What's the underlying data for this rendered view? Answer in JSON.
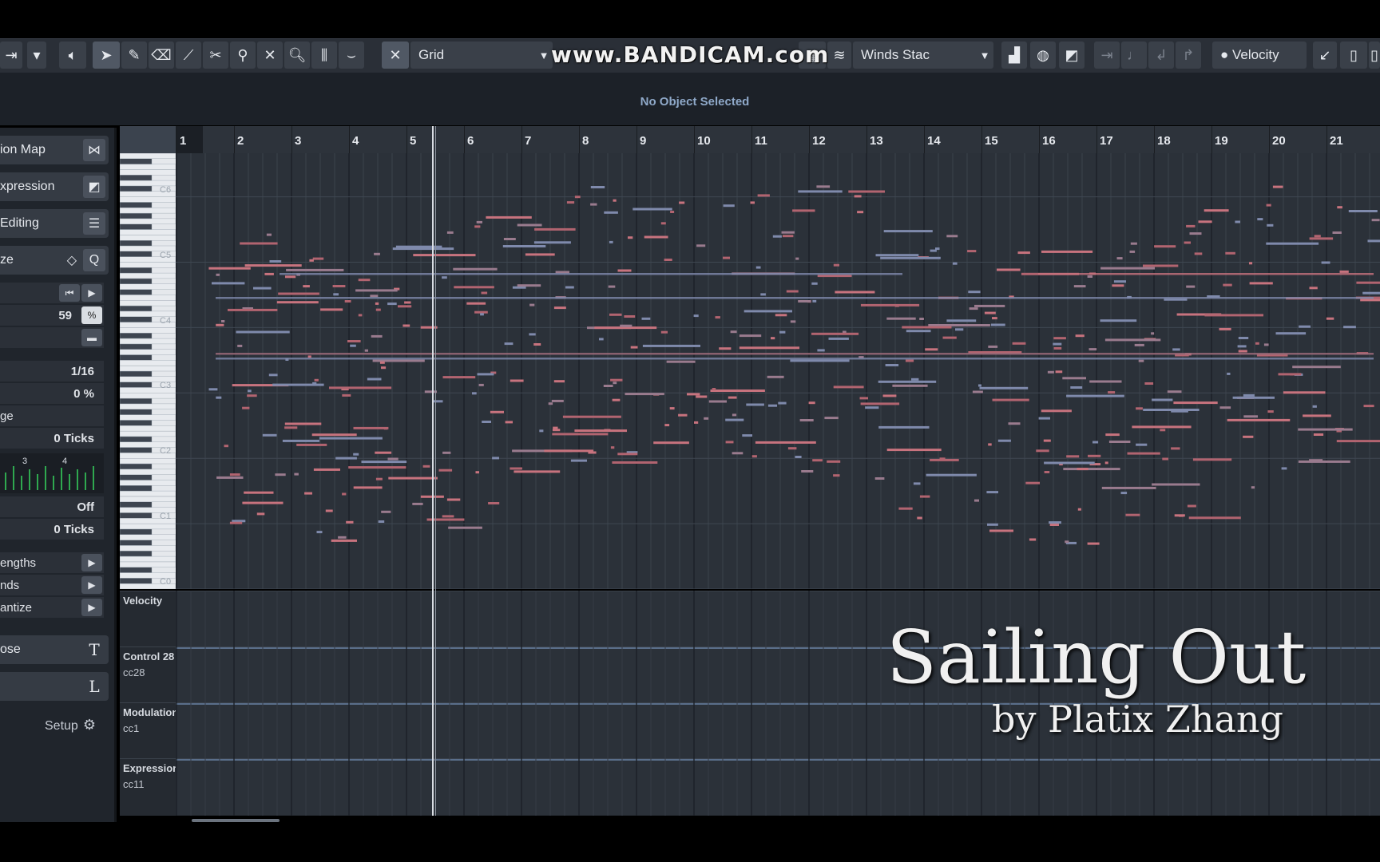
{
  "toolbar": {
    "quantize_label": "Grid",
    "bandicam": "www.BANDICAM.com",
    "instrument_label": "Winds Stac",
    "velocity_label": "Velocity"
  },
  "info_line": {
    "text": "No Object Selected"
  },
  "inspector": {
    "sections": [
      {
        "label": "ion Map",
        "icon": "⋈"
      },
      {
        "label": "xpression",
        "icon": "◩"
      },
      {
        "label": "Editing",
        "icon": "☰"
      },
      {
        "label": "ze",
        "icon": "Q"
      }
    ],
    "value_59": "59",
    "grid_value": "1/16",
    "percent": "0 %",
    "ge_label": "ge",
    "ticks1": "0 Ticks",
    "off": "Off",
    "ticks2": "0 Ticks",
    "func_rows": [
      "engths",
      "nds",
      "antize"
    ],
    "transpose": {
      "label": "ose",
      "icon": "T"
    },
    "logical": {
      "label": "",
      "icon": "L"
    },
    "setup": "Setup",
    "meter_labels": [
      "3",
      "4"
    ]
  },
  "ruler": {
    "bars": [
      "1",
      "2",
      "3",
      "4",
      "5",
      "6",
      "7",
      "8",
      "9",
      "10",
      "11",
      "12",
      "13",
      "14",
      "15",
      "16",
      "17",
      "18",
      "19",
      "20",
      "21"
    ]
  },
  "keyboard": {
    "labels": [
      "C6",
      "C5",
      "C4",
      "C3",
      "C2",
      "C1",
      "C0"
    ]
  },
  "lanes": [
    {
      "name": "Velocity",
      "cc": ""
    },
    {
      "name": "Control 28",
      "cc": "cc28"
    },
    {
      "name": "Modulation",
      "cc": "cc1"
    },
    {
      "name": "Expression",
      "cc": "cc11"
    }
  ],
  "overlay": {
    "title": "Sailing Out",
    "subtitle": "by Platix Zhang"
  },
  "colors": {
    "note_red": "#c8737e",
    "note_blue": "#7f8aac",
    "accent": "#8fa9c9"
  }
}
